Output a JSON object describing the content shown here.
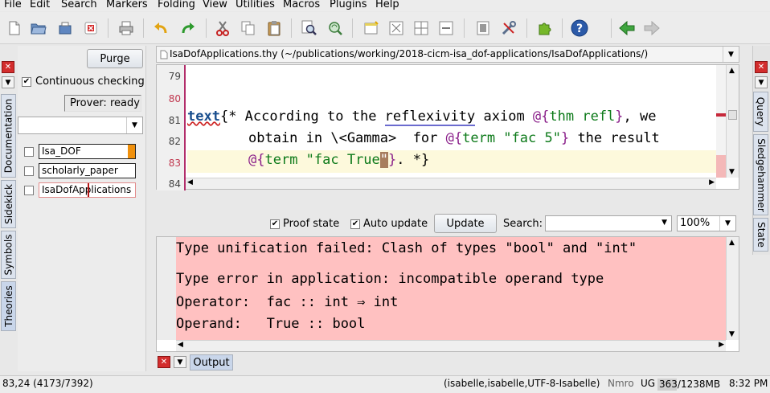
{
  "menu": [
    "File",
    "Edit",
    "Search",
    "Markers",
    "Folding",
    "View",
    "Utilities",
    "Macros",
    "Plugins",
    "Help"
  ],
  "toolbar_icons": [
    "new-file-icon",
    "open-folder-icon",
    "reload-icon",
    "close-file-icon",
    "print-icon",
    "undo-icon",
    "redo-icon",
    "cut-icon",
    "copy-icon",
    "paste-icon",
    "find-icon",
    "find-replace-icon",
    "new-view-icon",
    "split-view-icon",
    "unsplit-view-icon",
    "toggle-fullscreen-icon",
    "tools-icon",
    "plugin-icon",
    "help-icon",
    "back-arrow-icon",
    "forward-arrow-icon"
  ],
  "left_tabs": [
    "Documentation",
    "Sidekick",
    "Symbols",
    "Theories"
  ],
  "right_tabs": [
    "Query",
    "Sledgehammer",
    "State"
  ],
  "theories": {
    "purge_label": "Purge",
    "continuous_checking": "Continuous checking",
    "prover_status": "Prover: ready",
    "items": [
      {
        "name": "Isa_DOF"
      },
      {
        "name": "scholarly_paper"
      },
      {
        "name": "IsaDofApplications"
      }
    ]
  },
  "buffer": {
    "title": "IsaDofApplications.thy (~/publications/working/2018-cicm-isa_dof-applications/IsaDofApplications/)"
  },
  "editor": {
    "line_numbers": [
      "79",
      "80",
      "81",
      "82",
      "83",
      "84"
    ],
    "l81": {
      "kw": "text",
      "open": "{*",
      "t1": " According to the ",
      "t2": "reflexivity",
      "t3": " axiom ",
      "at": "@{",
      "thm": "thm refl",
      "close": "}",
      "t4": ", we"
    },
    "l82": {
      "t1": "obtain in \\<Gamma>  for ",
      "at": "@{",
      "term": "term \"fac 5\"",
      "close": "}",
      "t2": " the result"
    },
    "l83": {
      "at": "@{",
      "term": "term \"fac True",
      "cursor": "\"",
      "close": "}",
      "t2": ". *}"
    }
  },
  "output_toolbar": {
    "proof_state": "Proof state",
    "auto_update": "Auto update",
    "update_label": "Update",
    "search_label": "Search:",
    "zoom": "100%"
  },
  "output": {
    "lines": [
      "Type unification failed: Clash of types \"bool\" and \"int\"",
      "Type error in application: incompatible operand type",
      "Operator:  fac :: int ⇒ int",
      "Operand:   True :: bool"
    ]
  },
  "bottom_tab": "Output",
  "status": {
    "position": "83,24 (4173/7392)",
    "mode": "(isabelle,isabelle,UTF-8-Isabelle)",
    "flags": "Nmro",
    "ug": "UG",
    "memory": "363/1238MB",
    "time": "8:32 PM"
  }
}
